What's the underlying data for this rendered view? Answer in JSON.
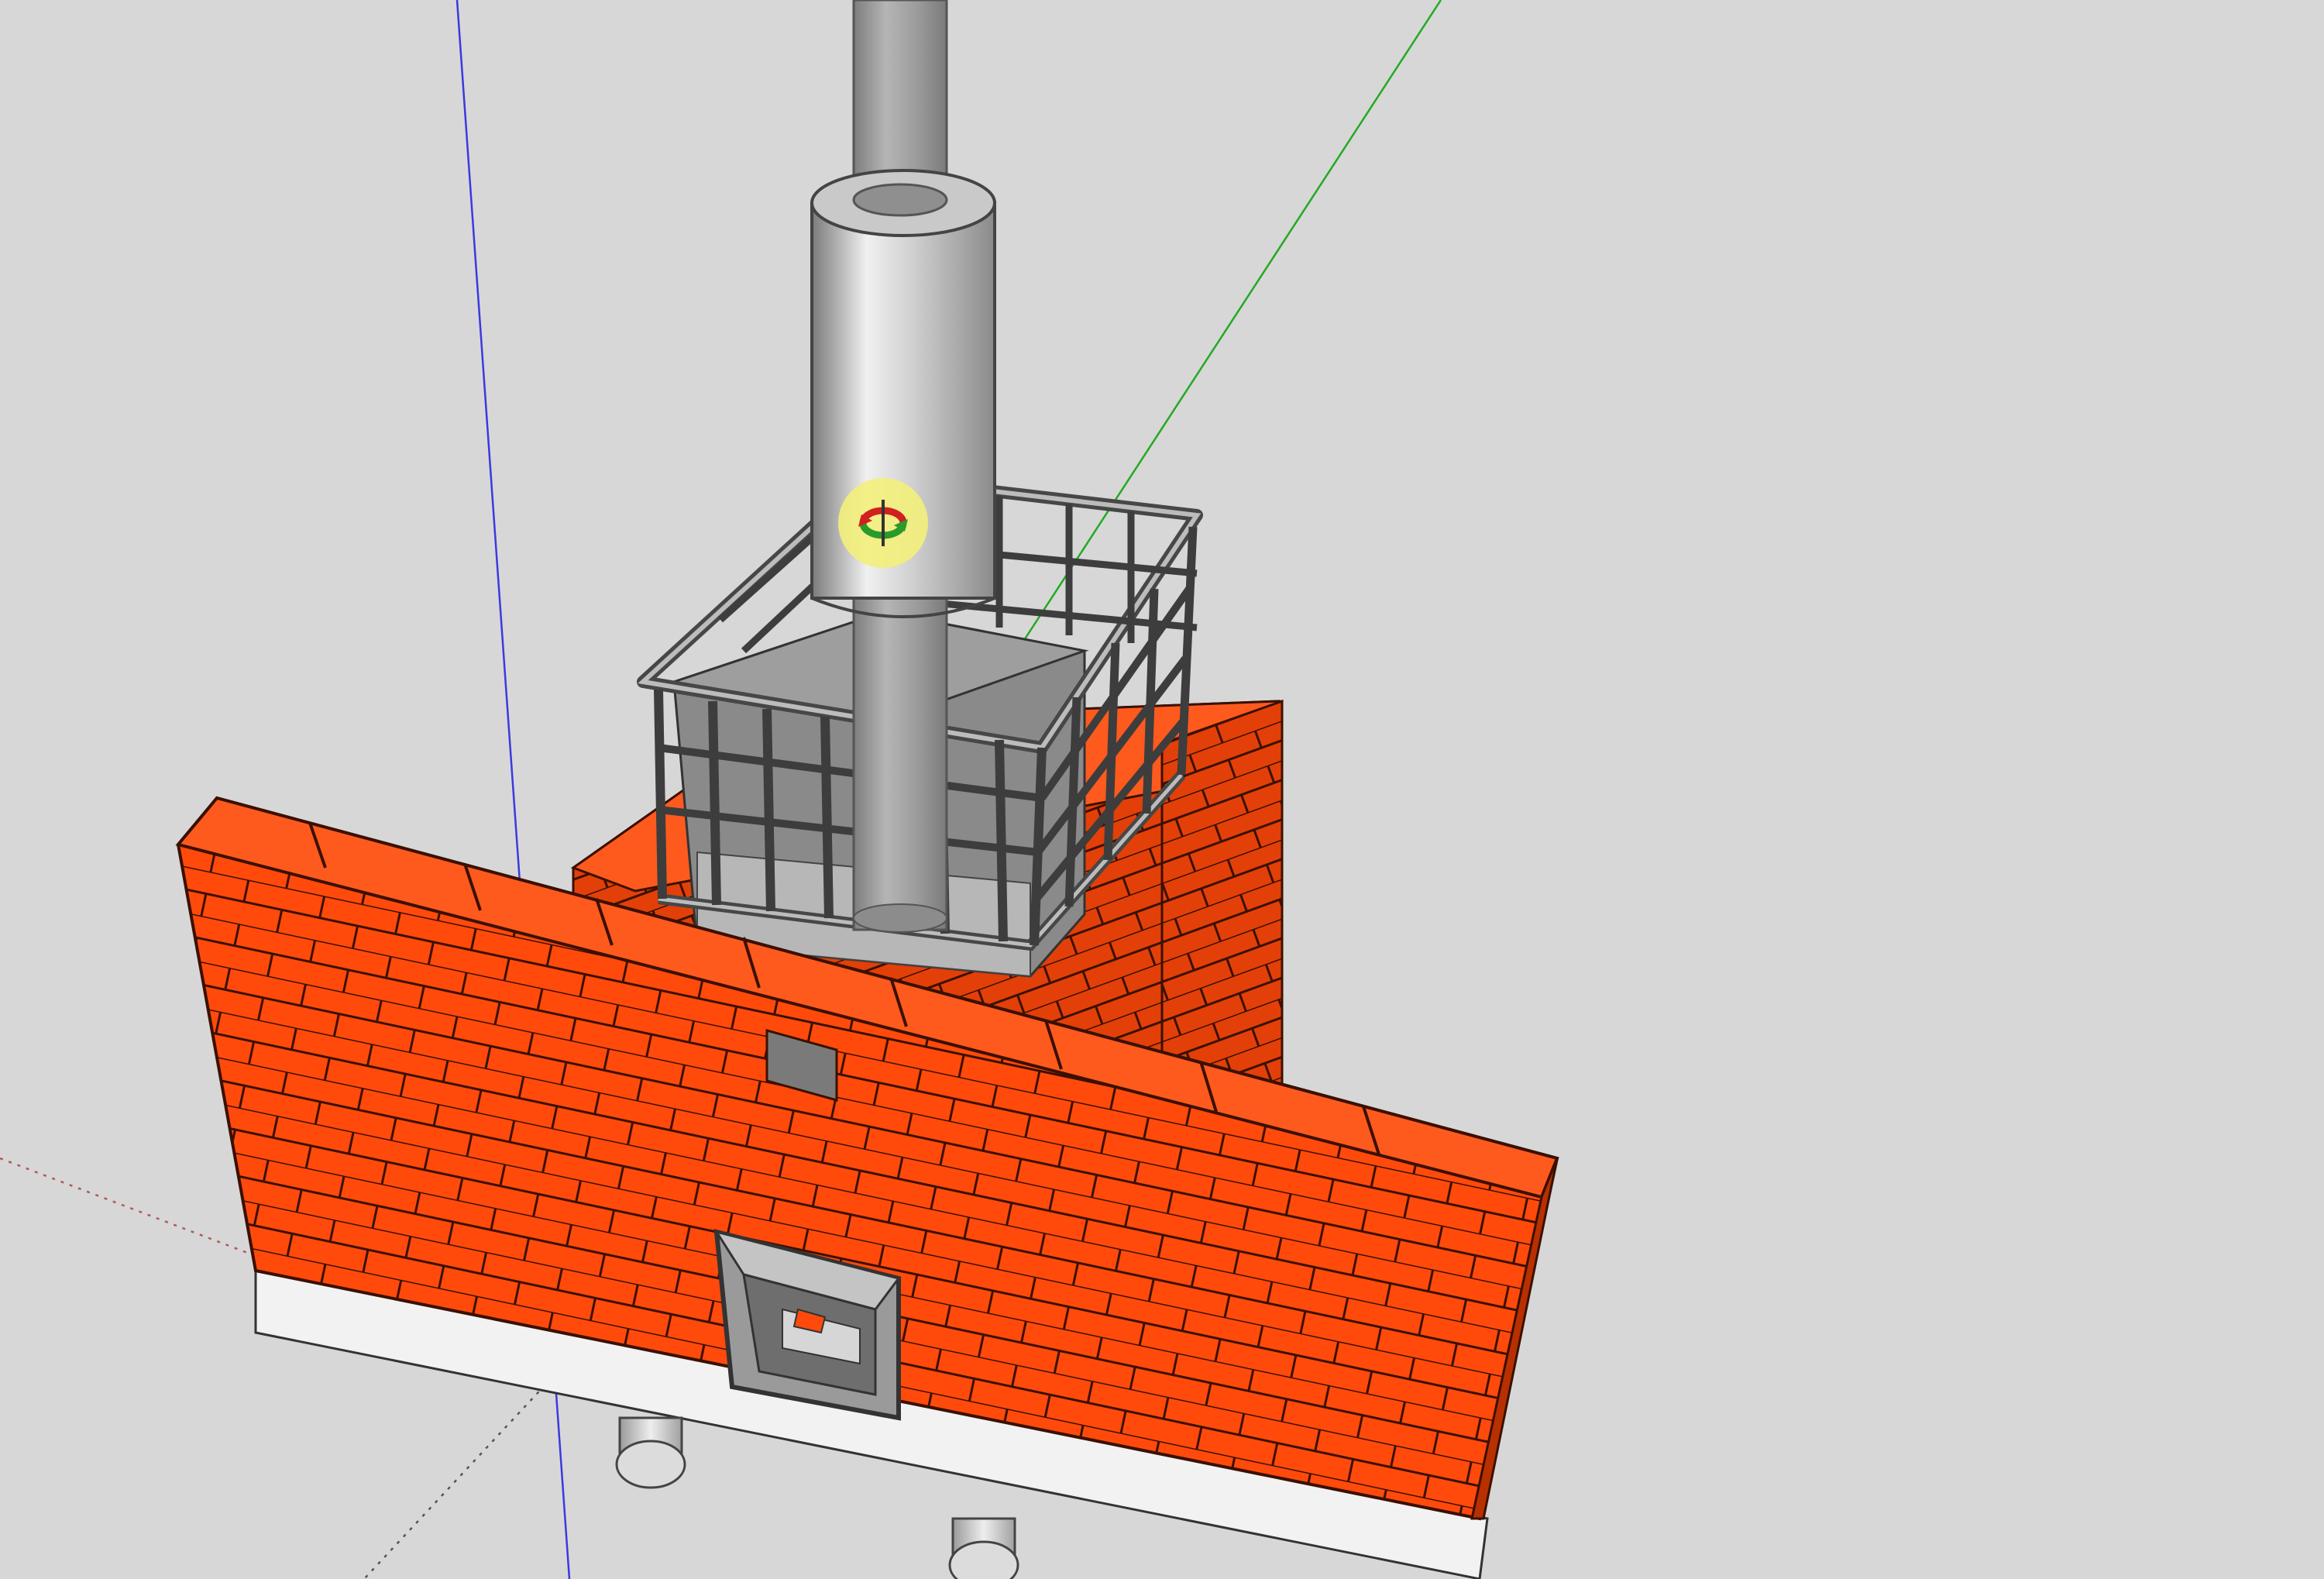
{
  "viewport": {
    "background": "#d7d7d7",
    "axis_colors": {
      "blue": "#3a3adf",
      "green": "#22aa22",
      "red_dotted": "#b05a5a",
      "black_dotted": "#555555"
    }
  },
  "model": {
    "brick_color": "#ff4a0c",
    "brick_dark": "#cc3500",
    "brick_top": "#ff5a1e",
    "mortar_color": "#4a1200",
    "base_color": "#f2f2f2",
    "metal_color": "#a9a9a9",
    "metal_dark": "#5a5a5a",
    "pipe_color": "#9b9b9b",
    "sleeve_color": "#c8c8c8"
  },
  "tool": {
    "icon": "orbit-tool-icon",
    "halo_color": "#f2ef7a"
  }
}
